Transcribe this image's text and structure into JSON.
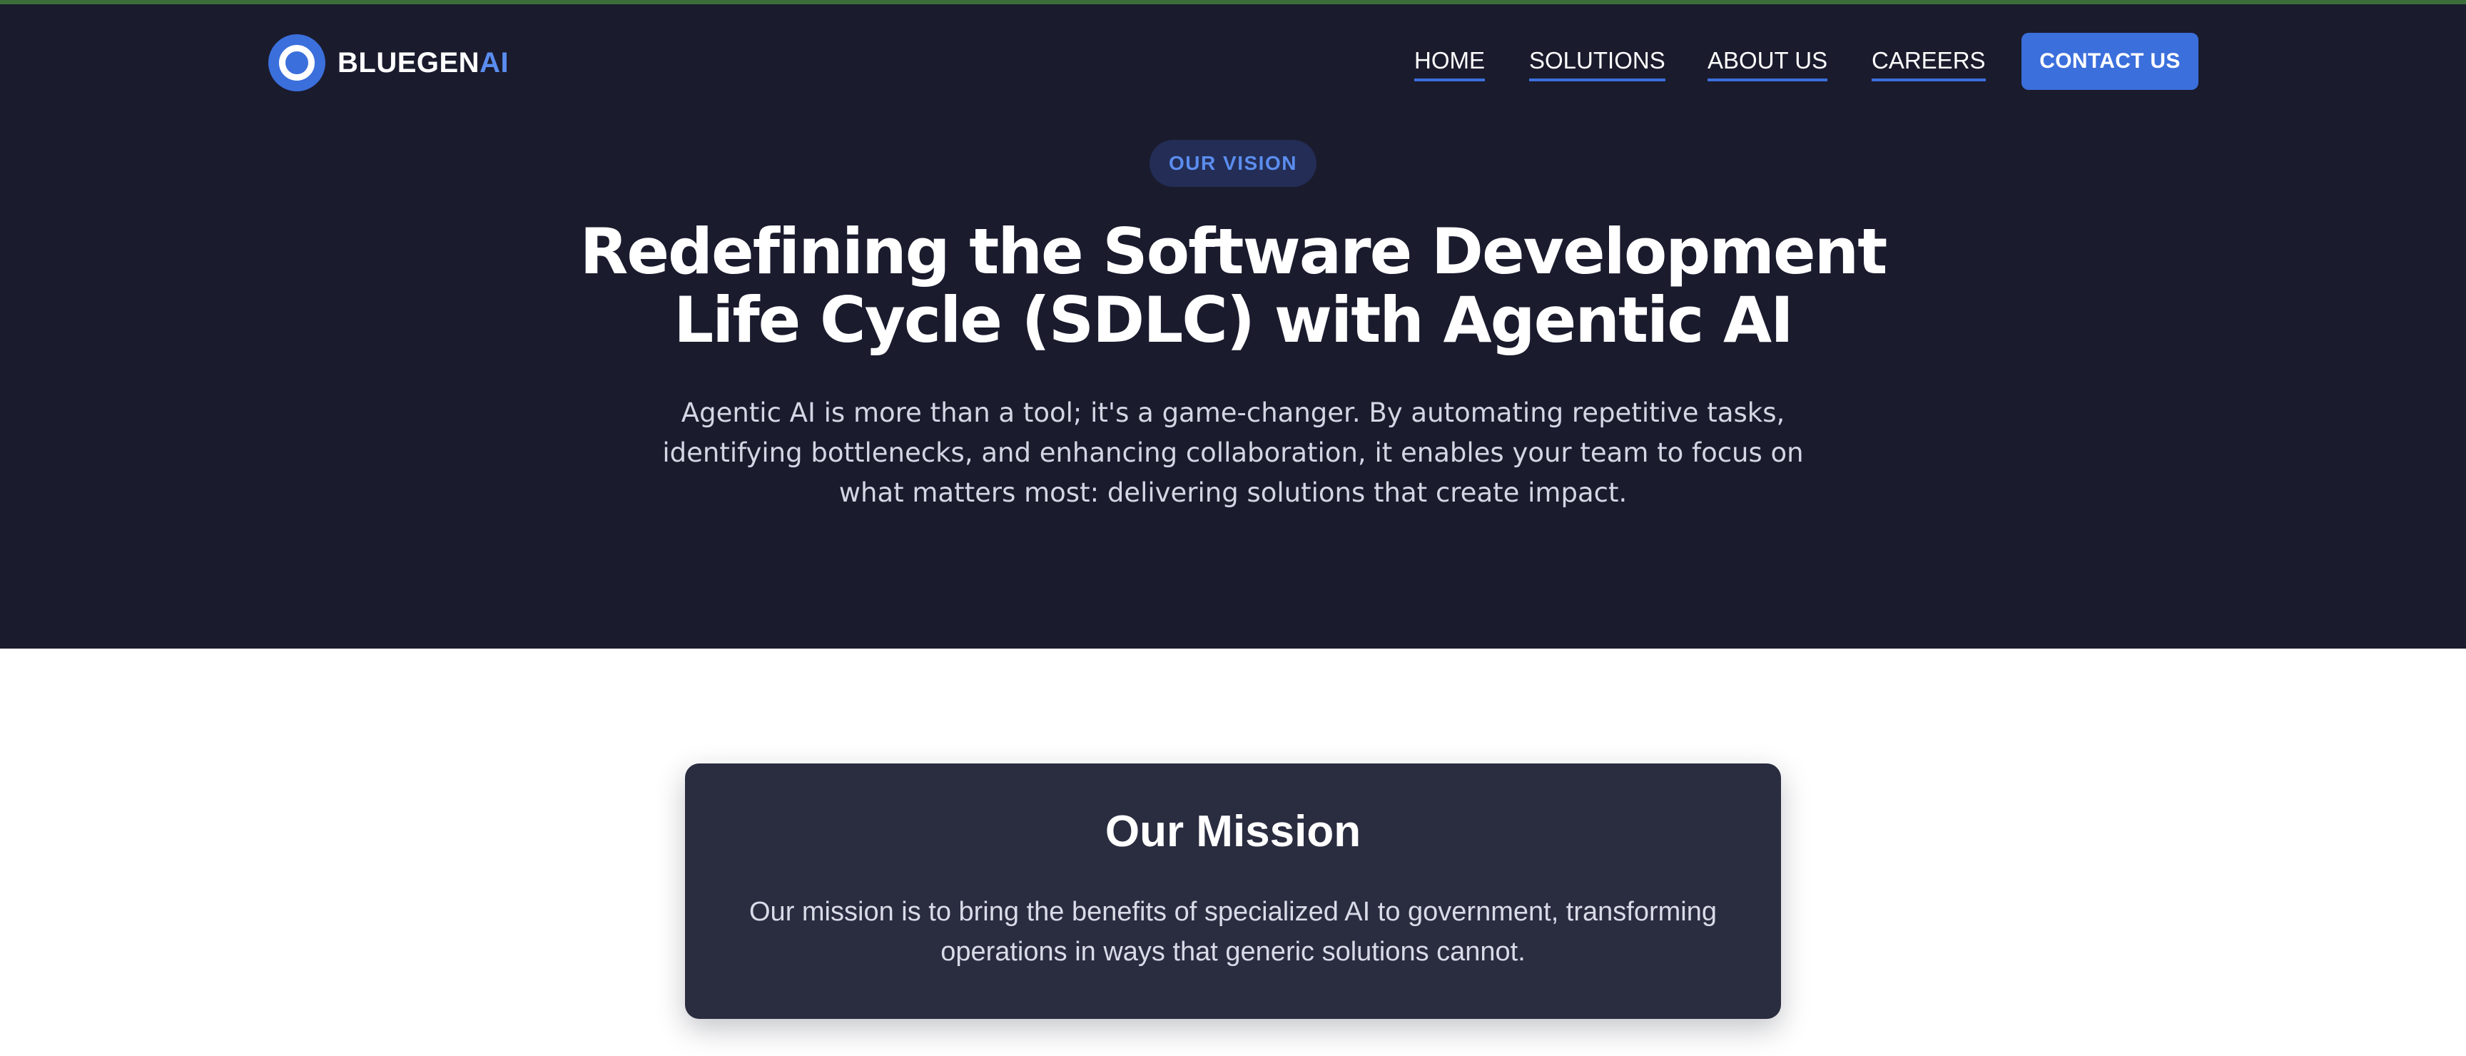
{
  "brand": {
    "name_primary": "BLUEGEN",
    "name_accent": "AI",
    "accent_color": "#3b6fdc",
    "hero_bg": "#1a1b2d",
    "card_bg": "#2a2c40"
  },
  "nav": {
    "items": [
      {
        "label": "HOME"
      },
      {
        "label": "SOLUTIONS"
      },
      {
        "label": "ABOUT US"
      },
      {
        "label": "CAREERS"
      }
    ],
    "cta_label": "CONTACT US"
  },
  "hero": {
    "eyebrow": "OUR VISION",
    "title_line1": "Redefining the Software Development",
    "title_line2": "Life Cycle (SDLC) with Agentic AI",
    "description": "Agentic AI is more than a tool; it's a game-changer. By automating repetitive tasks, identifying bottlenecks, and enhancing collaboration, it enables your team to focus on what matters most: delivering solutions that create impact."
  },
  "mission": {
    "title": "Our Mission",
    "text": "Our mission is to bring the benefits of specialized AI to government, transforming operations in ways that generic solutions cannot."
  }
}
